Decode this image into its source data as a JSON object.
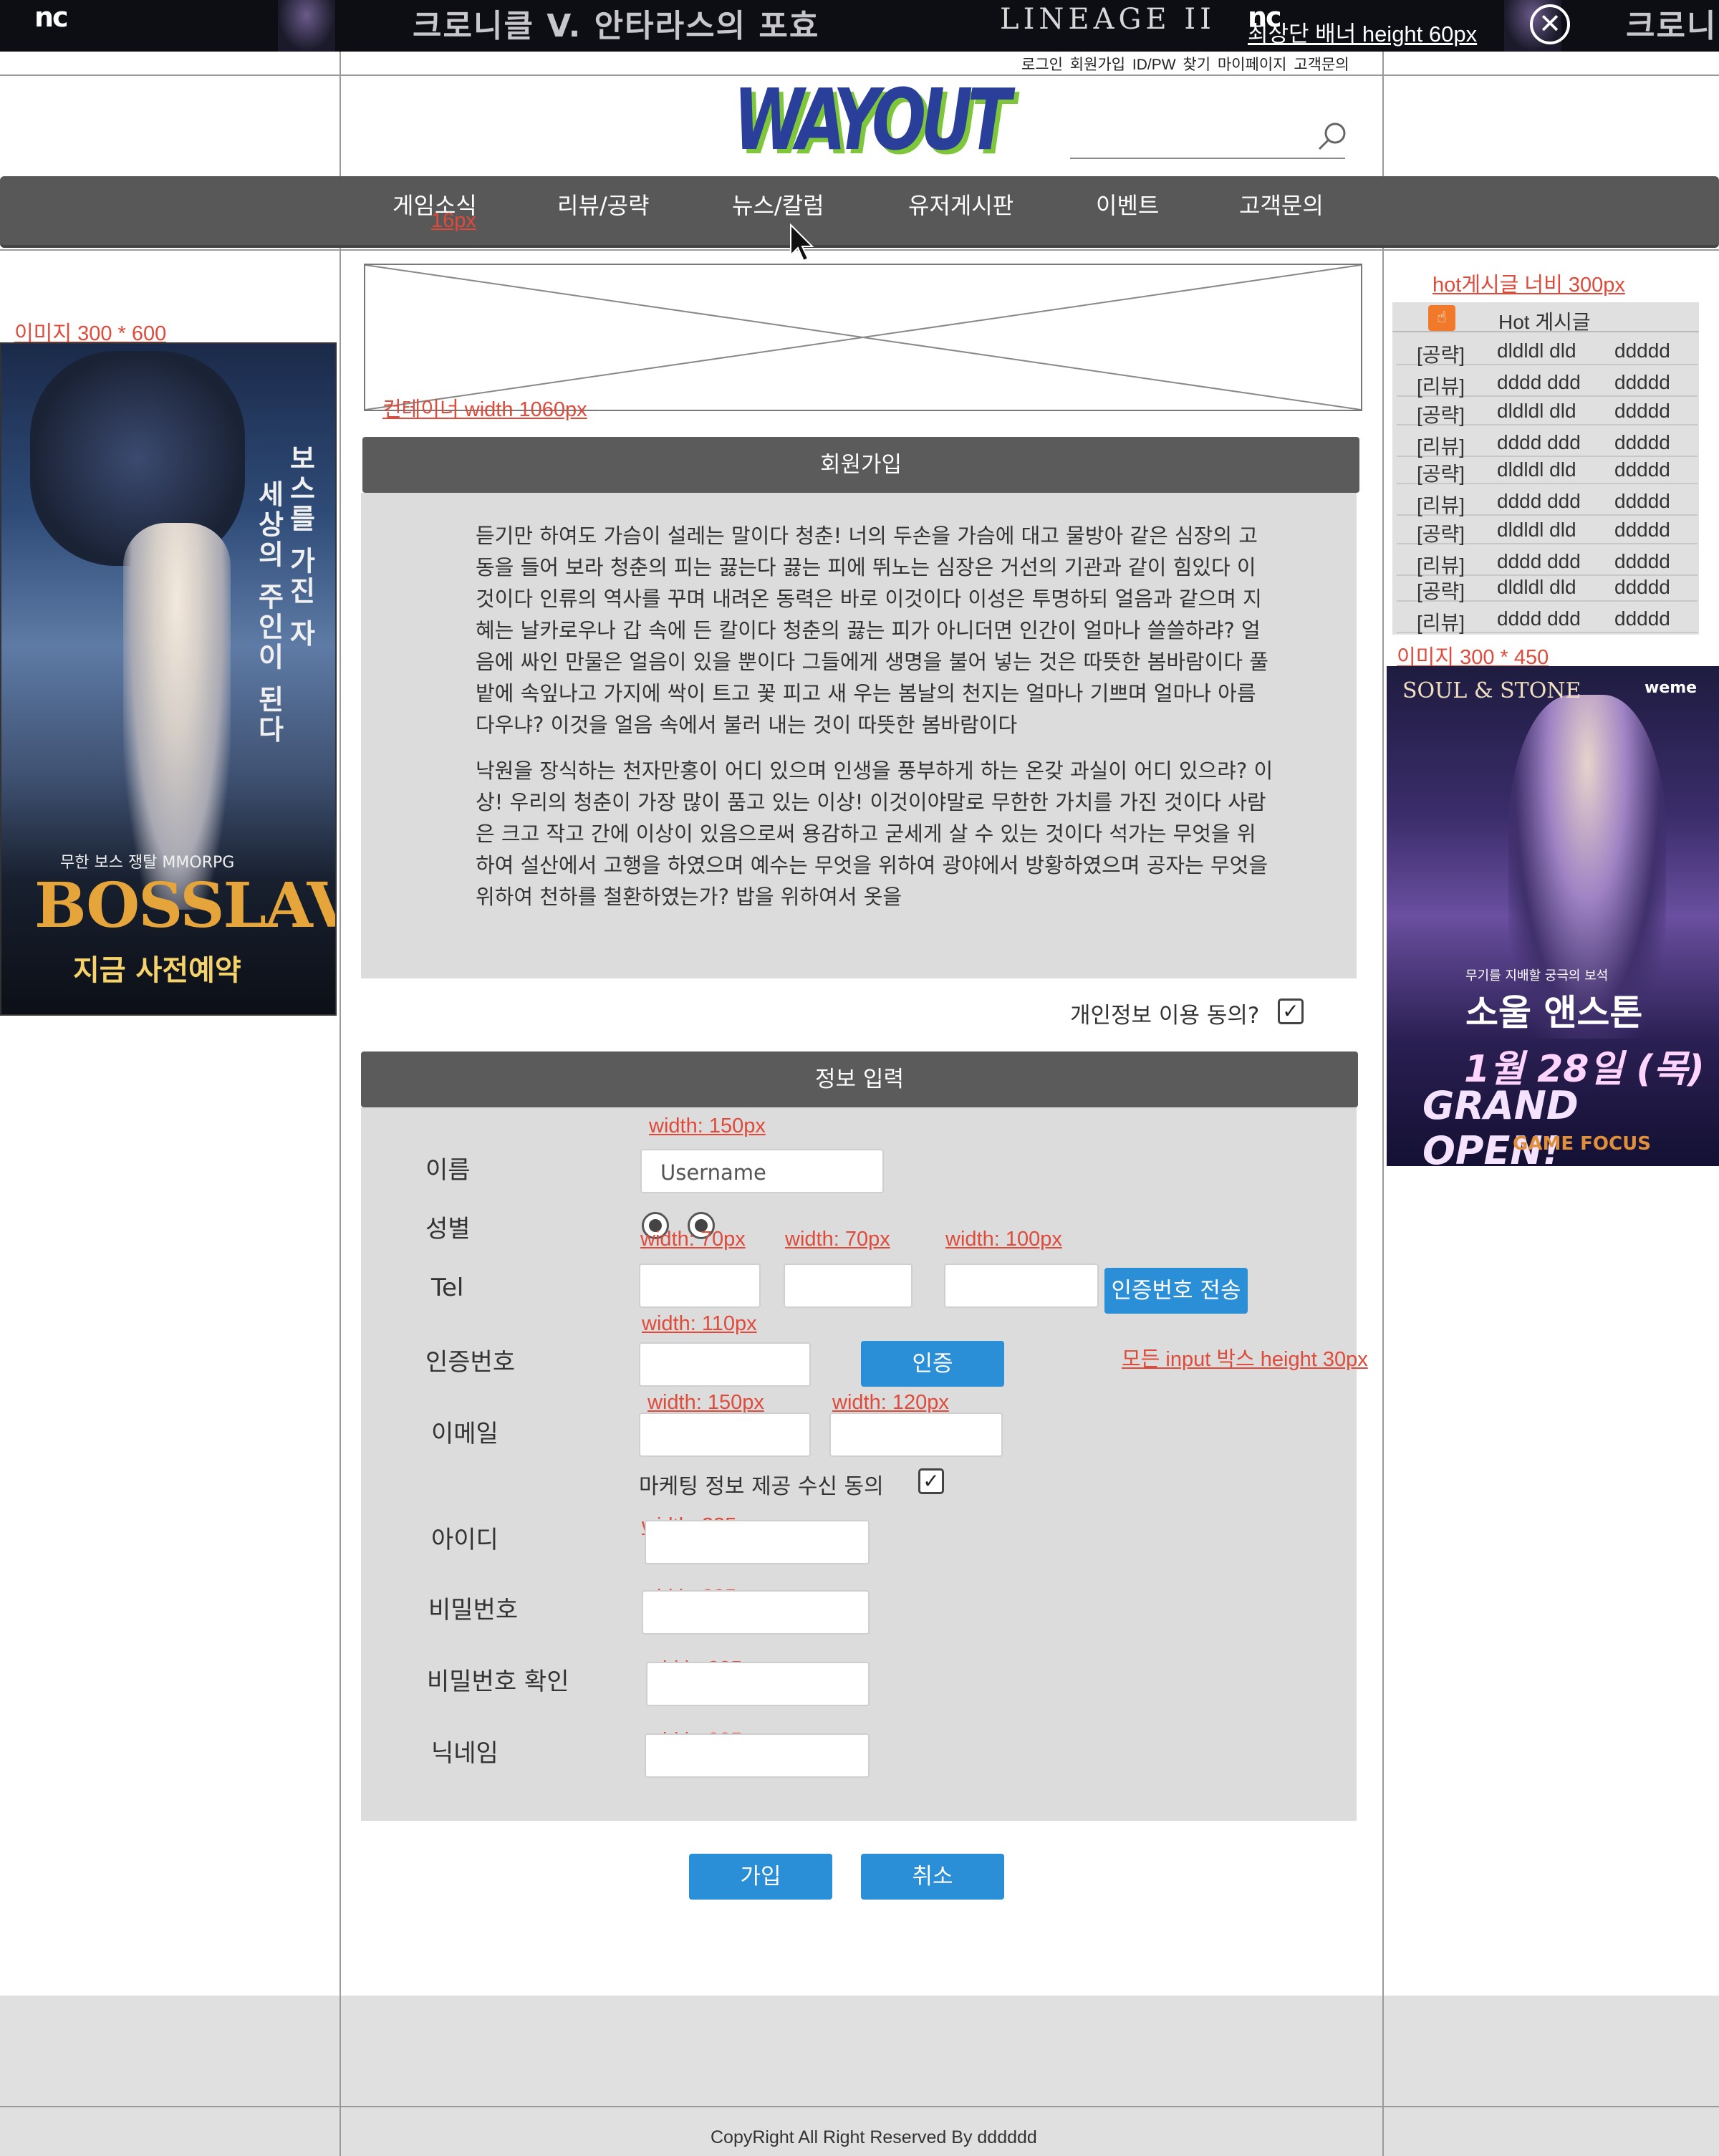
{
  "top_banner": {
    "nc_logo": "nc",
    "title": "크로니클 V. 안타라스의 포효",
    "title_repeat": "크로니클",
    "lineage": "LINEAGE II",
    "note": "최상단 배너 height 60px",
    "close_glyph": "✕"
  },
  "utility_links": "로그인 회원가입 ID/PW 찾기 마이페이지 고객문의",
  "logo_text": "WAYOUT",
  "nav": {
    "items": [
      "게임소식",
      "리뷰/공략",
      "뉴스/칼럼",
      "유저게시판",
      "이벤트",
      "고객문의"
    ],
    "note": "16px"
  },
  "left_ad": {
    "note": "이미지 300 * 600",
    "vertical_text_1": "보스를 가진 자",
    "vertical_text_2": "세상의 주인이 된다",
    "sub": "무한 보스 쟁탈 MMORPG",
    "name": "BOSSLAVE",
    "cta": "지금 사전예약"
  },
  "placeholder_note": "컨테이너 width 1060px",
  "signup": {
    "header": "회원가입",
    "paragraphs": [
      "듣기만 하여도 가슴이 설레는 말이다 청춘! 너의 두손을 가슴에 대고 물방아 같은 심장의 고동을 들어 보라 청춘의 피는 끓는다 끓는 피에 뛰노는 심장은 거선의 기관과 같이 힘있다 이것이다 인류의 역사를 꾸며 내려온 동력은 바로 이것이다 이성은 투명하되 얼음과 같으며 지혜는 날카로우나 갑 속에 든 칼이다 청춘의 끓는 피가 아니더면 인간이 얼마나 쓸쓸하랴? 얼음에 싸인 만물은 얼음이 있을 뿐이다 그들에게 생명을 불어 넣는 것은 따뜻한 봄바람이다 풀밭에 속잎나고 가지에 싹이 트고 꽃 피고 새 우는 봄날의 천지는 얼마나 기쁘며 얼마나 아름다우냐? 이것을 얼음 속에서 불러 내는 것이 따뜻한 봄바람이다",
      "낙원을 장식하는 천자만홍이 어디 있으며 인생을 풍부하게 하는 온갖 과실이 어디 있으랴? 이상! 우리의 청춘이 가장 많이 품고 있는 이상! 이것이야말로 무한한 가치를 가진 것이다 사람은 크고 작고 간에 이상이 있음으로써 용감하고 굳세게 살 수 있는 것이다 석가는 무엇을 위하여 설산에서 고행을 하였으며 예수는 무엇을 위하여 광야에서 방황하였으며 공자는 무엇을 위하여 천하를 철환하였는가? 밥을 위하여서 옷을"
    ],
    "agree_label": "개인정보 이용 동의?",
    "agree_check": "✓"
  },
  "info_form": {
    "header": "정보 입력",
    "labels": {
      "name": "이름",
      "gender": "성별",
      "tel": "Tel",
      "auth": "인증번호",
      "email": "이메일",
      "id": "아이디",
      "password": "비밀번호",
      "password_confirm": "비밀번호 확인",
      "nickname": "닉네임"
    },
    "name_placeholder": "Username",
    "send_code_button": "인증번호 전송",
    "verify_button": "인증",
    "marketing_label": "마케팅 정보 제공 수신 동의",
    "marketing_check": "✓",
    "notes": {
      "name_width": "width: 150px",
      "tel1_width": "width: 70px",
      "tel2_width": "width: 70px",
      "tel3_width": "width: 100px",
      "auth_width": "width: 110px",
      "input_height": "모든 input 박스 height 30px",
      "email1_width": "width: 150px",
      "email2_width": "width: 120px",
      "id_width": "width: 235px",
      "pw_width": "width: 235px",
      "pwc_width": "width: 235px",
      "nick_width": "width: 235px"
    },
    "join_button": "가입",
    "cancel_button": "취소"
  },
  "hot_board": {
    "note": "hot게시글 너비 300px",
    "title": "Hot 게시글",
    "rows": [
      {
        "tag": "[공략]",
        "title": "dldldl dld",
        "author": "ddddd"
      },
      {
        "tag": "[리뷰]",
        "title": "dddd ddd",
        "author": "ddddd"
      },
      {
        "tag": "[공략]",
        "title": "dldldl dld",
        "author": "ddddd"
      },
      {
        "tag": "[리뷰]",
        "title": "dddd ddd",
        "author": "ddddd"
      },
      {
        "tag": "[공략]",
        "title": "dldldl dld",
        "author": "ddddd"
      },
      {
        "tag": "[리뷰]",
        "title": "dddd ddd",
        "author": "ddddd"
      },
      {
        "tag": "[공략]",
        "title": "dldldl dld",
        "author": "ddddd"
      },
      {
        "tag": "[리뷰]",
        "title": "dddd ddd",
        "author": "ddddd"
      },
      {
        "tag": "[공략]",
        "title": "dldldl dld",
        "author": "ddddd"
      },
      {
        "tag": "[리뷰]",
        "title": "dddd ddd",
        "author": "ddddd"
      }
    ]
  },
  "right_ad": {
    "note": "이미지 300 * 450",
    "logo": "SOUL & STONE",
    "weme": "weme",
    "sub": "무기를 지배할 궁극의 보석",
    "title": "소울 앤스톤",
    "date": "1월 28일 (목)",
    "open": "GRAND OPEN!",
    "gf": "GAME FOCUS"
  },
  "footer": {
    "copyright": "CopyRight All Right Reserved  By dddddd"
  },
  "colors": {
    "nav_bg": "#585858",
    "section_header_bg": "#5b5b5b",
    "section_body_bg": "#dcdcdc",
    "button_blue": "#2b8fd7",
    "note_red": "#e04a3a",
    "logo_blue": "#2a3f9a",
    "logo_green": "#7ec63a"
  },
  "icons": {
    "search": "search-icon",
    "close": "close-icon",
    "thumb": "thumbs-up-icon",
    "cursor": "cursor-icon"
  }
}
